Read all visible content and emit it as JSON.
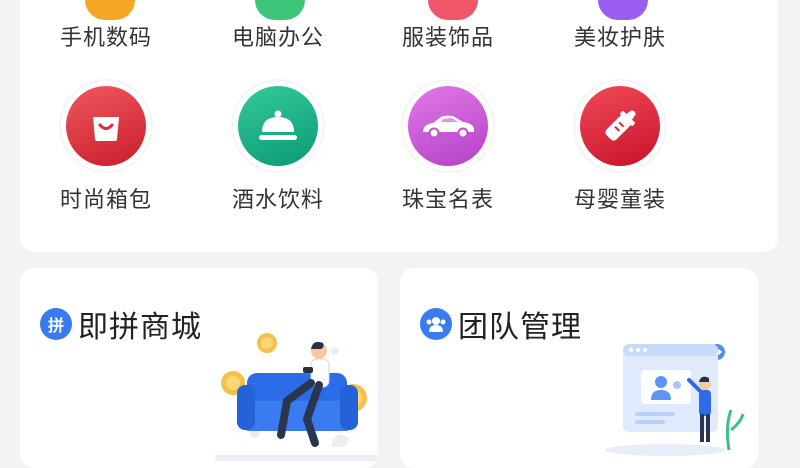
{
  "categories": [
    {
      "label": "手机数码",
      "icon": "phone-icon",
      "color": "#f5a623"
    },
    {
      "label": "电脑办公",
      "icon": "computer-icon",
      "color": "#3fc57a"
    },
    {
      "label": "服装饰品",
      "icon": "clothing-icon",
      "color": "#f0566a"
    },
    {
      "label": "美妆护肤",
      "icon": "cosmetics-icon",
      "color": "#9b5cf0"
    },
    {
      "label": "时尚箱包",
      "icon": "bag-icon",
      "color": "#e23c45"
    },
    {
      "label": "酒水饮料",
      "icon": "food-cover-icon",
      "color": "#18b58a"
    },
    {
      "label": "珠宝名表",
      "icon": "car-icon",
      "color": "#d05cd8"
    },
    {
      "label": "母婴童装",
      "icon": "baby-bottle-icon",
      "color": "#e5253a"
    }
  ],
  "promos": [
    {
      "title": "即拼商城",
      "badge": "拼",
      "icon": "group-buy-icon"
    },
    {
      "title": "团队管理",
      "badge": "",
      "icon": "team-icon"
    }
  ],
  "colors": {
    "accent": "#3b7bf2",
    "background": "#f2f3f5"
  }
}
